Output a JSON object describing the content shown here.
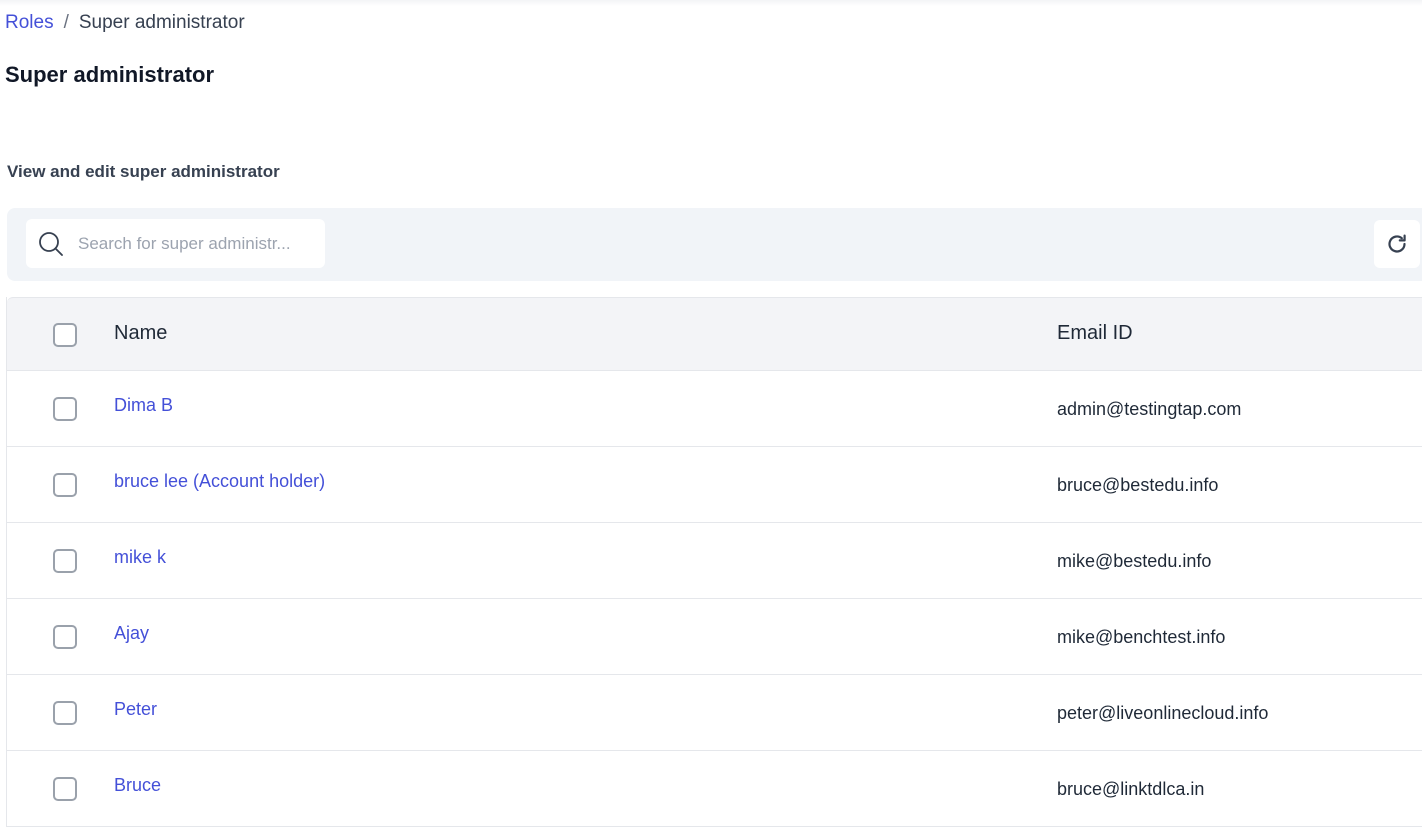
{
  "breadcrumb": {
    "parent": "Roles",
    "separator": "/",
    "current": "Super administrator"
  },
  "page": {
    "title": "Super administrator",
    "subtitle": "View and edit super administrator"
  },
  "search": {
    "placeholder": "Search for super administr...",
    "value": ""
  },
  "icons": {
    "search": "search-icon",
    "refresh": "refresh-icon"
  },
  "table": {
    "columns": {
      "name": "Name",
      "email": "Email ID"
    },
    "rows": [
      {
        "name": "Dima B",
        "email": "admin@testingtap.com"
      },
      {
        "name": "bruce lee (Account holder)",
        "email": "bruce@bestedu.info"
      },
      {
        "name": "mike k",
        "email": "mike@bestedu.info"
      },
      {
        "name": "Ajay",
        "email": "mike@benchtest.info"
      },
      {
        "name": "Peter",
        "email": "peter@liveonlinecloud.info"
      },
      {
        "name": "Bruce",
        "email": "bruce@linktdlca.in"
      }
    ]
  },
  "colors": {
    "link": "#4450d8",
    "toolbar_bg": "#f1f4f8",
    "header_bg": "#f3f4f7"
  }
}
